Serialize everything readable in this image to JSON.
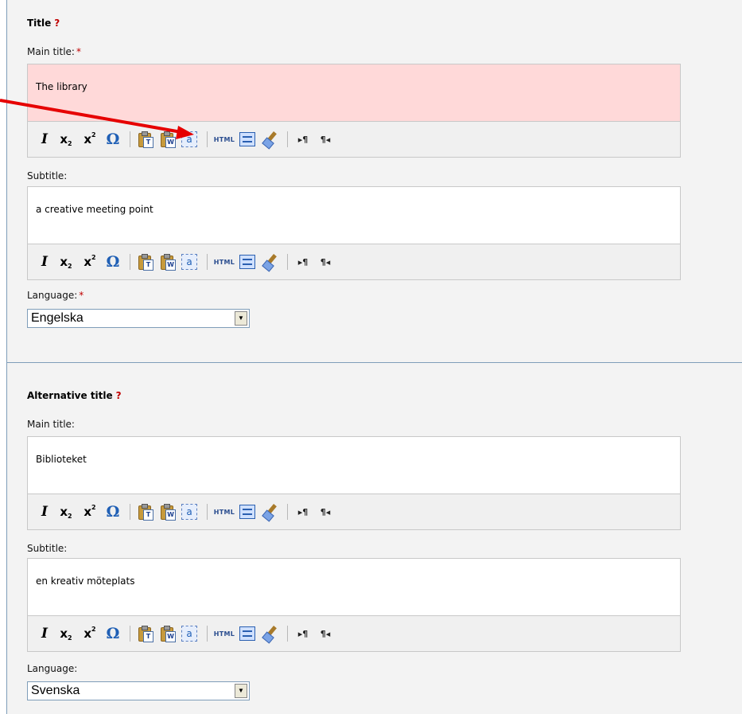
{
  "sections": [
    {
      "title": "Title",
      "help_mark": "?",
      "main_title_label": "Main title:",
      "main_title_required": "*",
      "main_title_value": "The library",
      "subtitle_label": "Subtitle:",
      "subtitle_value": "a creative meeting point",
      "language_label": "Language:",
      "language_required": "*",
      "language_value": "Engelska"
    },
    {
      "title": "Alternative title",
      "help_mark": "?",
      "main_title_label": "Main title:",
      "main_title_value": "Biblioteket",
      "subtitle_label": "Subtitle:",
      "subtitle_value": "en kreativ möteplats",
      "language_label": "Language:",
      "language_value": "Svenska"
    }
  ],
  "toolbar": {
    "italic": "I",
    "subscript": "x",
    "subscript_mark": "2",
    "superscript": "x",
    "superscript_mark": "2",
    "special_char": "Ω",
    "paste_text_glyph": "T",
    "paste_word_glyph": "W",
    "select_all_glyph": "a",
    "html_label": "HTML",
    "ltr_label": "▸¶",
    "rtl_label": "¶◂"
  },
  "colors": {
    "panel_bg": "#f3f3f3",
    "invalid_field_bg": "#ffd9d9",
    "required_mark": "#c00000",
    "annotation_arrow": "#e60000"
  }
}
